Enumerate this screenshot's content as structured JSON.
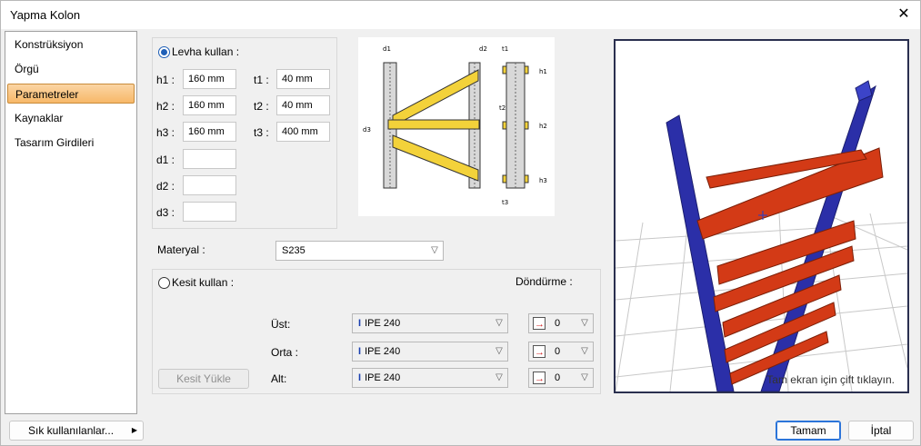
{
  "window": {
    "title": "Yapma Kolon"
  },
  "sidebar": {
    "items": [
      {
        "label": "Konstrüksiyon"
      },
      {
        "label": "Örgü"
      },
      {
        "label": "Parametreler"
      },
      {
        "label": "Kaynaklar"
      },
      {
        "label": "Tasarım Girdileri"
      }
    ]
  },
  "plate": {
    "radio_label": "Levha kullan :",
    "fields": {
      "h1": {
        "label": "h1 :",
        "value": "160 mm"
      },
      "h2": {
        "label": "h2 :",
        "value": "160 mm"
      },
      "h3": {
        "label": "h3 :",
        "value": "160 mm"
      },
      "t1": {
        "label": "t1 :",
        "value": "40 mm"
      },
      "t2": {
        "label": "t2 :",
        "value": "40 mm"
      },
      "t3": {
        "label": "t3 :",
        "value": "400 mm"
      },
      "d1": {
        "label": "d1 :",
        "value": ""
      },
      "d2": {
        "label": "d2 :",
        "value": ""
      },
      "d3": {
        "label": "d3 :",
        "value": ""
      }
    }
  },
  "diagram": {
    "labels": {
      "d1": "d1",
      "d2": "d2",
      "d3": "d3",
      "t1": "t1",
      "t2": "t2",
      "t3": "t3",
      "h1": "h1",
      "h2": "h2",
      "h3": "h3"
    }
  },
  "material": {
    "label": "Materyal :",
    "value": "S235"
  },
  "section": {
    "radio_label": "Kesit kullan :",
    "rotation_header": "Döndürme :",
    "load_button": "Kesit Yükle",
    "rows": [
      {
        "label": "Üst:",
        "profile": "IPE 240",
        "rotation": "0"
      },
      {
        "label": "Orta :",
        "profile": "IPE 240",
        "rotation": "0"
      },
      {
        "label": "Alt:",
        "profile": "IPE 240",
        "rotation": "0"
      }
    ]
  },
  "preview": {
    "hint": "Tam ekran için çift tıklayın."
  },
  "footer": {
    "favorites": "Sık kullanılanlar...",
    "ok": "Tamam",
    "cancel": "İptal"
  },
  "colors": {
    "accent": "#2b74d9",
    "column": "#2b2fa8",
    "lacing": "#d33a16",
    "plate": "#f3d23a",
    "active_tab": "#f7b868"
  }
}
